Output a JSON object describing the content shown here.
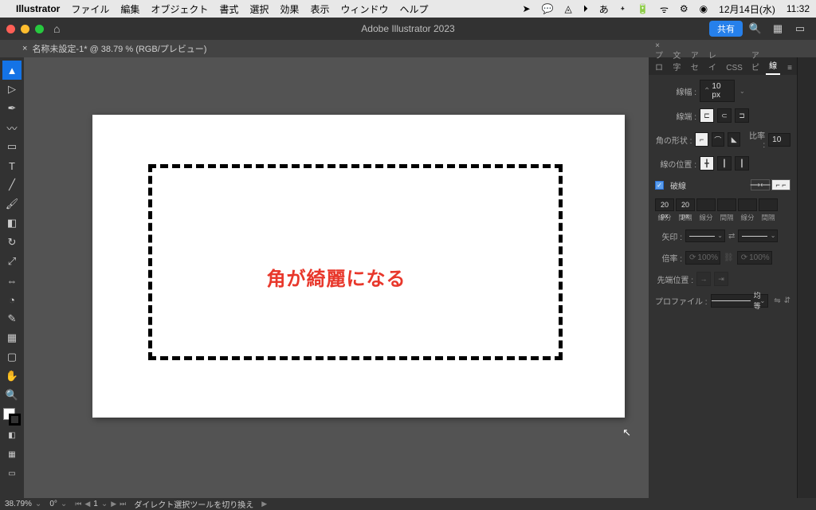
{
  "menubar": {
    "app": "Illustrator",
    "items": [
      "ファイル",
      "編集",
      "オブジェクト",
      "書式",
      "選択",
      "効果",
      "表示",
      "ウィンドウ",
      "ヘルプ"
    ],
    "date": "12月14日(水)",
    "time": "11:32"
  },
  "titlebar": {
    "title": "Adobe Illustrator 2023",
    "share": "共有"
  },
  "tab": {
    "name": "名称未設定-1* @ 38.79 % (RGB/プレビュー)"
  },
  "canvas": {
    "annotation": "角が綺麗になる"
  },
  "stroke_panel": {
    "tabs": [
      "プロ",
      "文字",
      "アセ",
      "レイ",
      "CSS",
      "アピ",
      "線"
    ],
    "weight_label": "線幅 :",
    "weight_value": "10 px",
    "cap_label": "線端 :",
    "corner_label": "角の形状 :",
    "miter_label": "比率 :",
    "miter_value": "10",
    "align_label": "線の位置 :",
    "dash_label": "破線",
    "dash_values": [
      "20 px",
      "20 px",
      "",
      "",
      "",
      ""
    ],
    "dash_sublabels": [
      "線分",
      "間隔",
      "線分",
      "間隔",
      "線分",
      "間隔"
    ],
    "arrow_label": "矢印 :",
    "scale_label": "倍率 :",
    "scale_value": "100%",
    "tip_align_label": "先端位置 :",
    "profile_label": "プロファイル :",
    "profile_value": "均等"
  },
  "statusbar": {
    "zoom": "38.79%",
    "rotate": "0°",
    "page": "1",
    "tool_hint": "ダイレクト選択ツールを切り換え"
  }
}
